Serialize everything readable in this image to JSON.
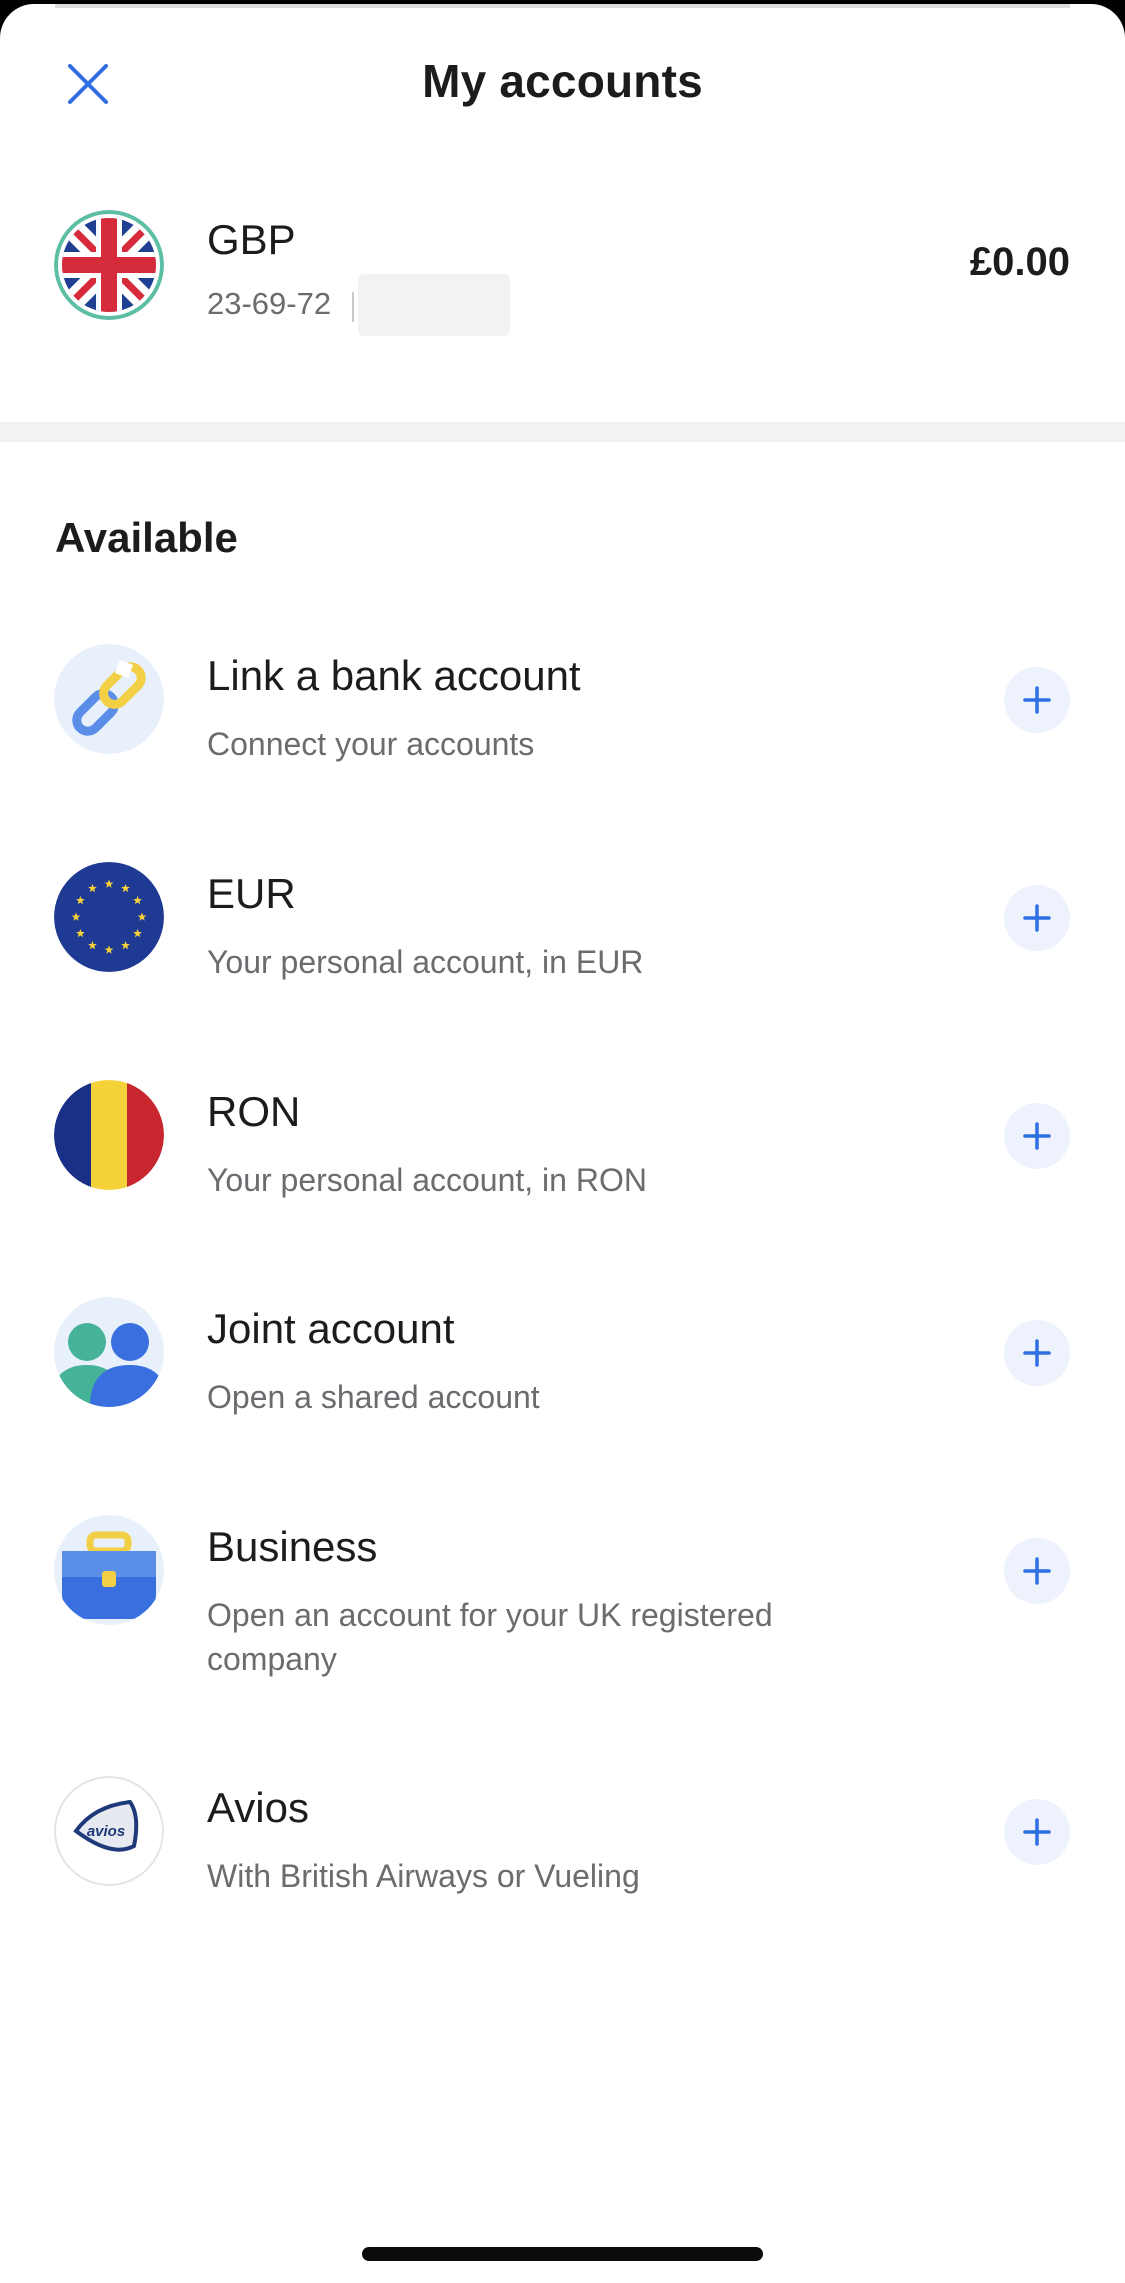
{
  "header": {
    "title": "My accounts",
    "close_icon": "close-icon"
  },
  "primary_account": {
    "name": "GBP",
    "sort_code": "23-69-72",
    "balance": "£0.00",
    "flag_icon": "uk-flag-icon"
  },
  "available": {
    "title": "Available",
    "items": [
      {
        "name": "Link a bank account",
        "desc": "Connect your accounts",
        "icon": "chain-link-icon"
      },
      {
        "name": "EUR",
        "desc": "Your personal account, in EUR",
        "icon": "eu-flag-icon"
      },
      {
        "name": "RON",
        "desc": "Your personal account, in RON",
        "icon": "romania-flag-icon"
      },
      {
        "name": "Joint account",
        "desc": "Open a shared account",
        "icon": "people-icon"
      },
      {
        "name": "Business",
        "desc": "Open an account for your UK registered company",
        "icon": "briefcase-icon"
      },
      {
        "name": "Avios",
        "desc": "With British Airways or Vueling",
        "icon": "avios-logo-icon",
        "logo_text": "avios"
      }
    ]
  },
  "colors": {
    "accent": "#2f6fe4",
    "add_button_bg": "#eef2fd",
    "muted_text": "#6b6b70"
  }
}
